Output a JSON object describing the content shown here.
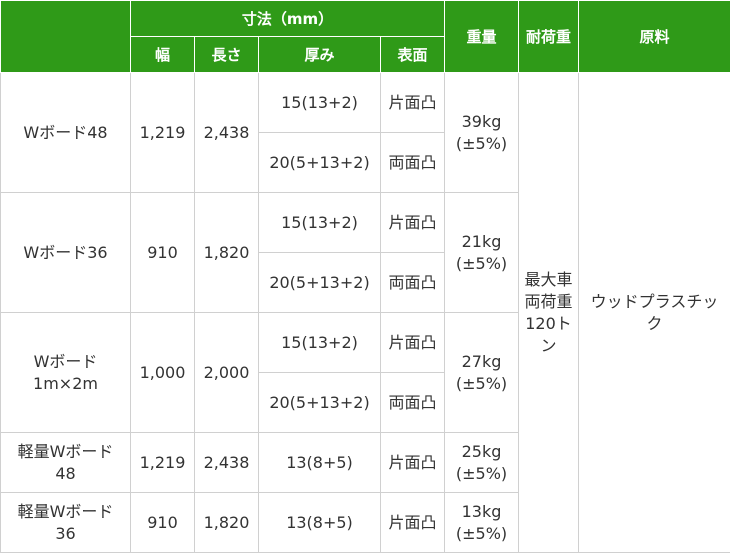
{
  "header": {
    "dimensions": "寸法（mm）",
    "width": "幅",
    "length": "長さ",
    "thickness": "厚み",
    "surface": "表面",
    "weight": "重量",
    "load_capacity": "耐荷重",
    "material": "原料"
  },
  "load_capacity_value": "最大車両荷重120トン",
  "material_value": "ウッドプラスチック",
  "products": [
    {
      "name": "Wボード48",
      "width": "1,219",
      "length": "2,438",
      "weight": "39kg (±5%)",
      "variants": [
        {
          "thickness": "15(13+2)",
          "surface": "片面凸"
        },
        {
          "thickness": "20(5+13+2)",
          "surface": "両面凸"
        }
      ]
    },
    {
      "name": "Wボード36",
      "width": "910",
      "length": "1,820",
      "weight": "21kg (±5%)",
      "variants": [
        {
          "thickness": "15(13+2)",
          "surface": "片面凸"
        },
        {
          "thickness": "20(5+13+2)",
          "surface": "両面凸"
        }
      ]
    },
    {
      "name": "Wボード 1m×2m",
      "width": "1,000",
      "length": "2,000",
      "weight": "27kg (±5%)",
      "variants": [
        {
          "thickness": "15(13+2)",
          "surface": "片面凸"
        },
        {
          "thickness": "20(5+13+2)",
          "surface": "両面凸"
        }
      ]
    },
    {
      "name": "軽量Wボード 48",
      "width": "1,219",
      "length": "2,438",
      "weight": "25kg (±5%)",
      "variants": [
        {
          "thickness": "13(8+5)",
          "surface": "片面凸"
        }
      ]
    },
    {
      "name": "軽量Wボード 36",
      "width": "910",
      "length": "1,820",
      "weight": "13kg (±5%)",
      "variants": [
        {
          "thickness": "13(8+5)",
          "surface": "片面凸"
        }
      ]
    }
  ]
}
